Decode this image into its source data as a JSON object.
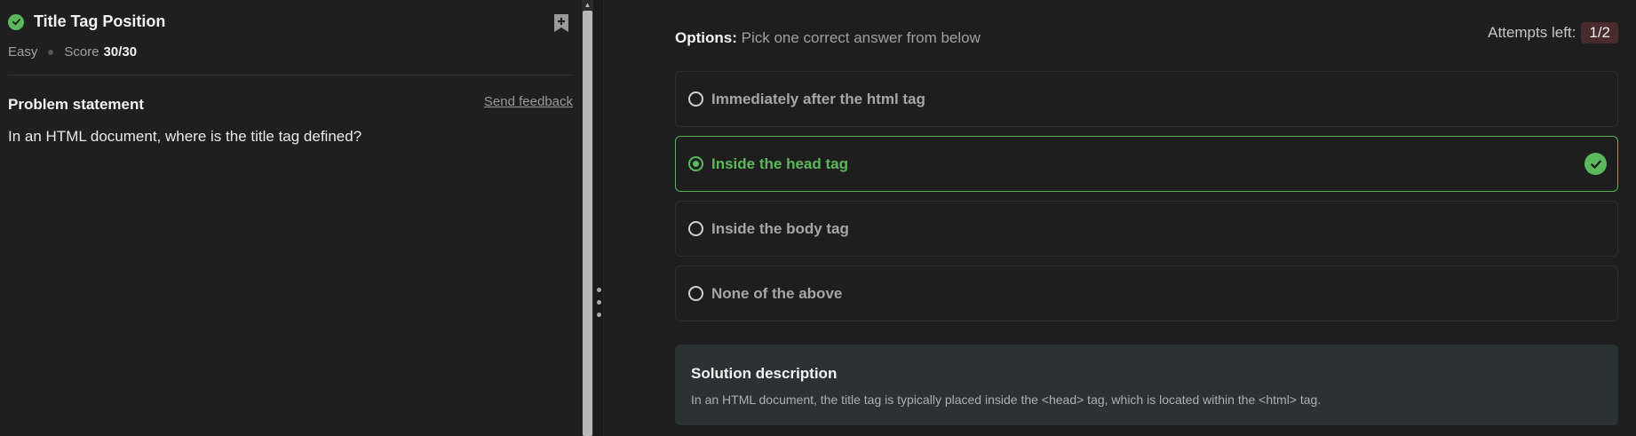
{
  "problem": {
    "title": "Title Tag Position",
    "difficulty": "Easy",
    "score_label": "Score",
    "score_value": "30/30",
    "statement_label": "Problem statement",
    "feedback_link": "Send feedback",
    "question": "In an HTML document, where is the title tag defined?"
  },
  "options_header": {
    "label": "Options:",
    "instruction": "Pick one correct answer from below"
  },
  "attempts": {
    "label": "Attempts left:",
    "value": "1/2"
  },
  "options": [
    {
      "label": "Immediately after the html tag",
      "selected": false
    },
    {
      "label": "Inside the head tag",
      "selected": true
    },
    {
      "label": "Inside the body tag",
      "selected": false
    },
    {
      "label": "None of the above",
      "selected": false
    }
  ],
  "solution": {
    "title": "Solution description",
    "text": "In an HTML document, the title tag is typically placed inside the <head> tag, which is located within the <html> tag."
  },
  "colors": {
    "success": "#5cb85c",
    "attempts_badge_bg": "#4a2b2b",
    "solution_bg": "#2a3234"
  },
  "icons": {
    "status": "check-circle-icon",
    "bookmark": "bookmark-add-icon",
    "correct": "check-circle-icon"
  }
}
